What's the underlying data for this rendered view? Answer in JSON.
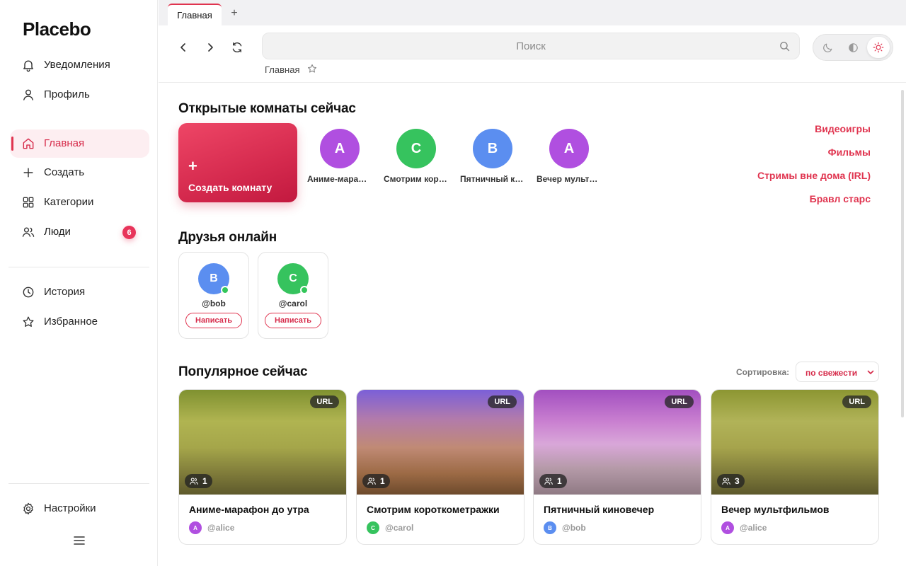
{
  "app": {
    "name": "Placebo"
  },
  "sidebar": {
    "top_items": [
      {
        "label": "Уведомления",
        "icon": "bell-icon"
      },
      {
        "label": "Профиль",
        "icon": "user-icon"
      }
    ],
    "nav_items": [
      {
        "label": "Главная",
        "icon": "home-icon",
        "active": true
      },
      {
        "label": "Создать",
        "icon": "plus-icon"
      },
      {
        "label": "Категории",
        "icon": "grid-icon"
      },
      {
        "label": "Люди",
        "icon": "users-icon",
        "badge": "6"
      }
    ],
    "secondary_items": [
      {
        "label": "История",
        "icon": "clock-icon"
      },
      {
        "label": "Избранное",
        "icon": "star-icon"
      }
    ],
    "settings_label": "Настройки",
    "accent_color": "#e0344f"
  },
  "browser": {
    "tabs": [
      {
        "label": "Главная"
      }
    ],
    "new_tab": "+",
    "search_placeholder": "Поиск",
    "breadcrumb": "Главная",
    "theme_options": [
      "dark",
      "contrast",
      "light"
    ],
    "theme_selected": "light"
  },
  "open_rooms": {
    "title": "Открытые комнаты сейчас",
    "create_label": "Создать комнату",
    "create_plus": "+",
    "rooms": [
      {
        "letter": "A",
        "name": "Аниме-марафон до утра",
        "color": "#b04fe0"
      },
      {
        "letter": "C",
        "name": "Смотрим короткометражки",
        "color": "#36c35e"
      },
      {
        "letter": "B",
        "name": "Пятничный киновечер",
        "color": "#5b8ef0"
      },
      {
        "letter": "A",
        "name": "Вечер мультфильмов",
        "color": "#b04fe0"
      }
    ],
    "categories": [
      "Видеоигры",
      "Фильмы",
      "Стримы вне дома (IRL)",
      "Бравл старс"
    ]
  },
  "friends": {
    "title": "Друзья онлайн",
    "items": [
      {
        "letter": "B",
        "handle": "@bob",
        "color": "#5b8ef0",
        "action": "Написать"
      },
      {
        "letter": "C",
        "handle": "@carol",
        "color": "#36c35e",
        "action": "Написать"
      }
    ]
  },
  "popular": {
    "title": "Популярное сейчас",
    "sort_label": "Сортировка:",
    "sort_value": "по свежести",
    "cards": [
      {
        "title": "Аниме-марафон до утра",
        "owner": "@alice",
        "owner_letter": "A",
        "owner_color": "#b04fe0",
        "badge": "URL",
        "viewers": "1",
        "thumb": "olive"
      },
      {
        "title": "Смотрим короткометражки",
        "owner": "@carol",
        "owner_letter": "C",
        "owner_color": "#36c35e",
        "badge": "URL",
        "viewers": "1",
        "thumb": "sunset"
      },
      {
        "title": "Пятничный киновечер",
        "owner": "@bob",
        "owner_letter": "B",
        "owner_color": "#5b8ef0",
        "badge": "URL",
        "viewers": "1",
        "thumb": "violet"
      },
      {
        "title": "Вечер мультфильмов",
        "owner": "@alice",
        "owner_letter": "A",
        "owner_color": "#b04fe0",
        "badge": "URL",
        "viewers": "3",
        "thumb": "olive"
      }
    ]
  }
}
